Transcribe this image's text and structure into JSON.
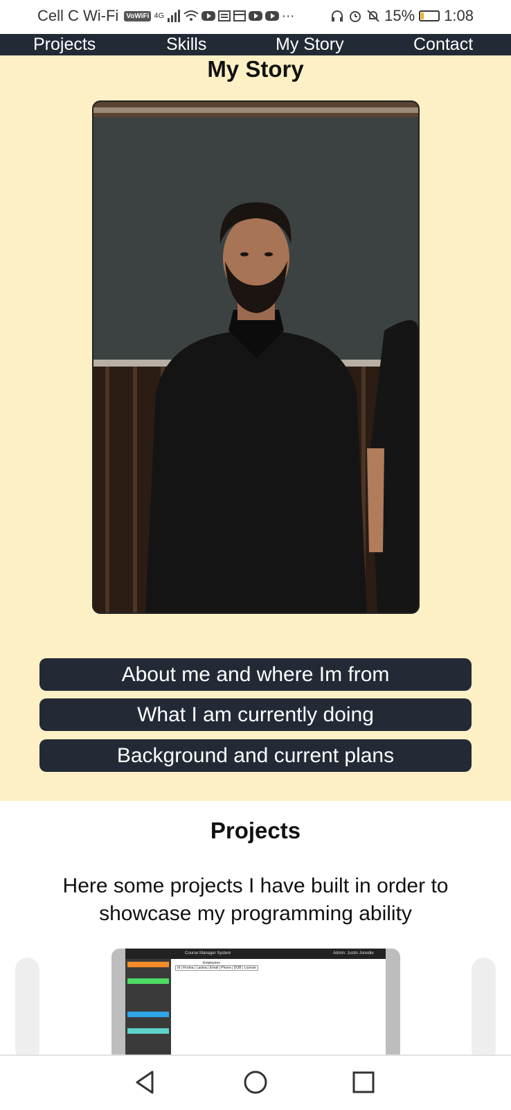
{
  "status_bar": {
    "carrier": "Cell C Wi-Fi",
    "vowifi": "VoWiFi",
    "network": "4G",
    "battery_percent": "15%",
    "time": "1:08",
    "battery_level": 0.15
  },
  "navbar": {
    "links": [
      "Projects",
      "Skills",
      "My Story",
      "Contact"
    ]
  },
  "story": {
    "title": "My Story",
    "buttons": [
      "About me and where Im from",
      "What I am currently doing",
      "Background and current plans"
    ]
  },
  "projects": {
    "title": "Projects",
    "description": "Here some projects I have built in order to showcase my programming ability",
    "preview": {
      "app_title": "Course Manager System",
      "admin": "Admin: Justin Jonedie",
      "section": "Employees",
      "columns": "Id | Firstna | Lastna | Email | Phone | DOB | License"
    }
  },
  "colors": {
    "navbar_bg": "#222a36",
    "story_bg": "#fdf0c5",
    "button_bg": "#232a36"
  }
}
